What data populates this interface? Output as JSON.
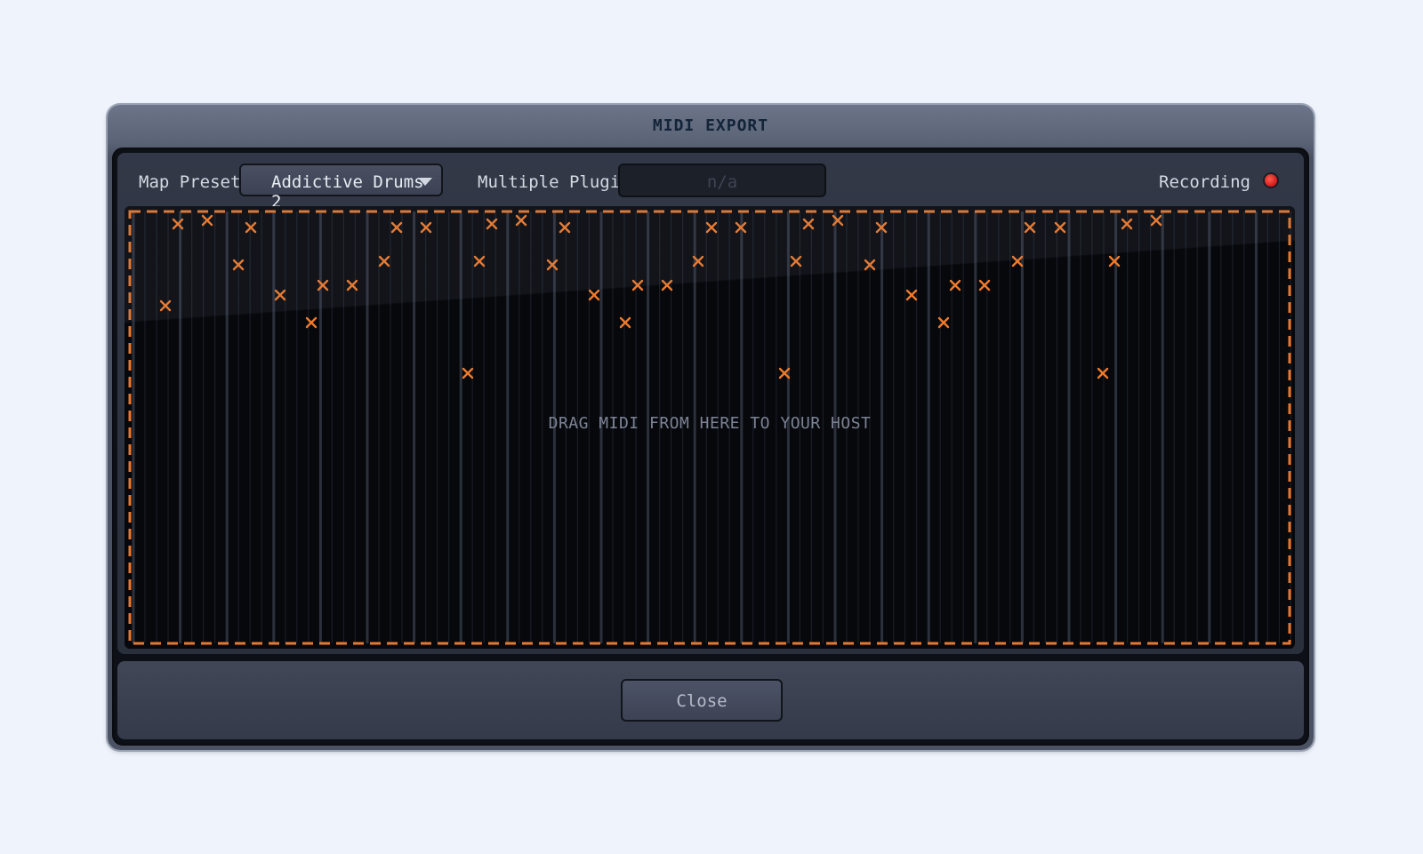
{
  "dialog": {
    "title": "MIDI EXPORT"
  },
  "toolbar": {
    "map_preset_label": "Map Preset",
    "map_preset_value": "Addictive Drums 2",
    "multiple_plugins_label": "Multiple Plugins",
    "multiple_plugins_value": "n/a",
    "recording_label": "Recording",
    "recording_indicator_color": "#e0201f"
  },
  "drop_zone": {
    "instruction": "DRAG MIDI FROM HERE TO YOUR HOST",
    "border_color": "#e8782e",
    "note_color": "#f07a2a",
    "note_icon": "x-mark"
  },
  "footer": {
    "close_label": "Close"
  }
}
